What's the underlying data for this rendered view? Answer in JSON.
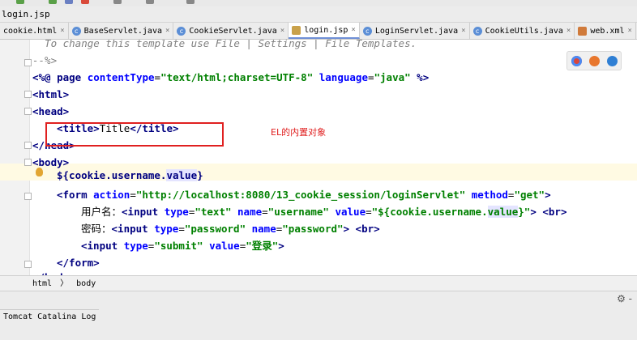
{
  "window": {
    "breadcrumb_file": "login.jsp"
  },
  "tabs": [
    {
      "label": "cookie.html",
      "icon": "html-file-icon",
      "active": false
    },
    {
      "label": "BaseServlet.java",
      "icon": "java-class-icon",
      "active": false
    },
    {
      "label": "CookieServlet.java",
      "icon": "java-class-icon",
      "active": false
    },
    {
      "label": "login.jsp",
      "icon": "jsp-file-icon",
      "active": true
    },
    {
      "label": "LoginServlet.java",
      "icon": "java-class-icon",
      "active": false
    },
    {
      "label": "CookieUtils.java",
      "icon": "java-class-icon",
      "active": false
    },
    {
      "label": "web.xml",
      "icon": "xml-file-icon",
      "active": false
    }
  ],
  "tab_close": "×",
  "editor": {
    "comment_line": "  To change this template use File | Settings | File Templates.",
    "comment_end": "--%>",
    "page_open": "<%@ ",
    "page_kw": "page ",
    "page_attr1": "contentType",
    "page_val1": "\"text/html;charset=UTF-8\"",
    "page_attr2": " language",
    "page_val2": "\"java\"",
    "page_close": " %>",
    "html_open": "<html>",
    "head_open": "<head>",
    "title_open": "<title>",
    "title_text": "Title",
    "title_close": "</title>",
    "head_close": "</head>",
    "body_open": "<body>",
    "el_prefix": "${cookie.username.",
    "el_value": "value",
    "el_suffix": "}",
    "form_tag": "<form ",
    "form_attr1": "action",
    "form_val1": "\"http://localhost:8080/13_cookie_session/loginServlet\"",
    "form_attr2": " method",
    "form_val2": "\"get\"",
    "form_end": ">",
    "username_label": "用户名：",
    "input1_tag": "<input ",
    "input1_attr1": "type",
    "input1_val1": "\"text\"",
    "input1_attr2": " name",
    "input1_val2": "\"username\"",
    "input1_attr3": " value",
    "input1_val3_pre": "\"${cookie.username.",
    "input1_val3_hi": "value",
    "input1_val3_post": "}\"",
    "input1_end": ">",
    "br": " <br>",
    "password_label": "密码：",
    "input2_tag": "<input ",
    "input2_attr1": "type",
    "input2_val1": "\"password\"",
    "input2_attr2": " name",
    "input2_val2": "\"password\"",
    "input2_end": ">",
    "input3_tag": "<input ",
    "input3_attr1": "type",
    "input3_val1": "\"submit\"",
    "input3_attr2": " value",
    "input3_val2": "\"登录\"",
    "input3_end": ">",
    "form_close": "</form>",
    "body_close_partial": "</body>"
  },
  "annotation": "EL的内置对象",
  "status": {
    "crumb1": "html",
    "crumb2": "body"
  },
  "bottom_panel": {
    "tools": "⚙ -",
    "log_tab": "Tomcat Catalina Log"
  },
  "colors": {
    "annotation": "#e02020",
    "active_tab_underline": "#6f8fd6"
  }
}
